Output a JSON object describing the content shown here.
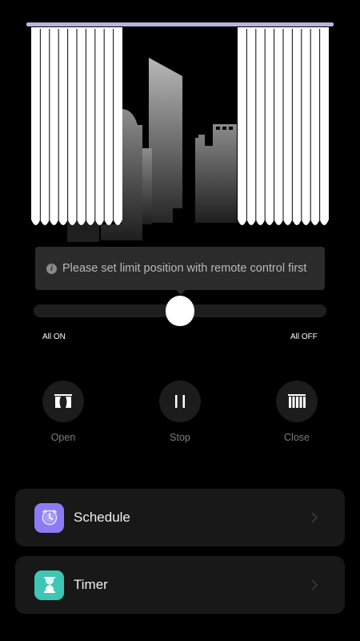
{
  "tooltip": {
    "icon": "info-icon",
    "text": "Please set limit position with remote control first"
  },
  "slider": {
    "left_label": "All ON",
    "right_label": "All OFF",
    "value_fraction": 0.5
  },
  "controls": [
    {
      "id": "open",
      "label": "Open",
      "icon": "curtain-open-icon"
    },
    {
      "id": "stop",
      "label": "Stop",
      "icon": "pause-icon"
    },
    {
      "id": "close",
      "label": "Close",
      "icon": "curtain-closed-icon"
    }
  ],
  "cards": [
    {
      "label": "Schedule",
      "icon": "clock-icon",
      "icon_color": "#8b7cf6"
    },
    {
      "label": "Timer",
      "icon": "hourglass-icon",
      "icon_color": "#3ec6b4"
    }
  ],
  "colors": {
    "rod": "#b7b3e0",
    "curtain": "#ffffff",
    "background": "#000000"
  }
}
